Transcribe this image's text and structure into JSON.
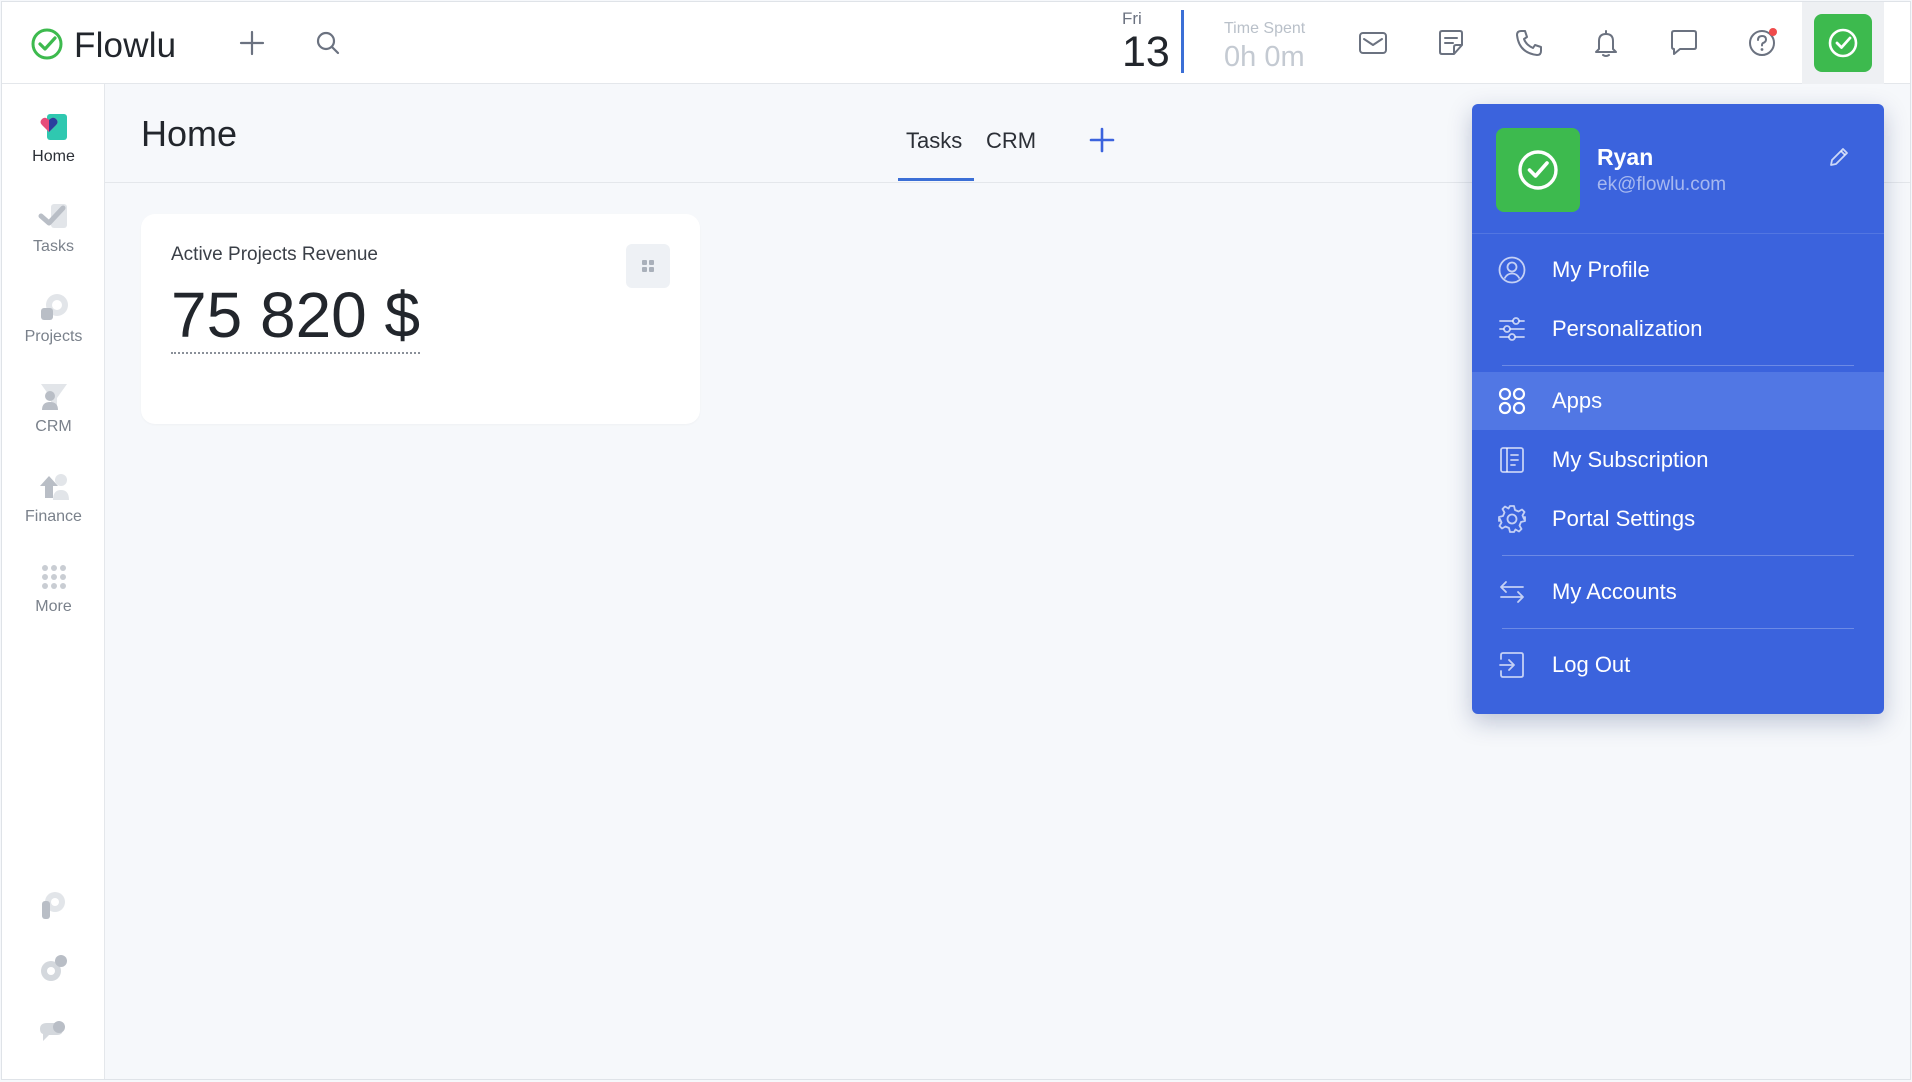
{
  "app": {
    "name": "Flowlu"
  },
  "topbar": {
    "date_day": "Fri",
    "date_num": "13",
    "time_spent_label": "Time Spent",
    "time_spent_value": "0h 0m",
    "icons": [
      "plus-icon",
      "search-icon",
      "mail-icon",
      "notes-icon",
      "phone-icon",
      "bell-icon",
      "chat-icon",
      "help-icon"
    ]
  },
  "sidebar": {
    "items": [
      {
        "label": "Home",
        "icon": "home-icon",
        "active": true
      },
      {
        "label": "Tasks",
        "icon": "tasks-icon"
      },
      {
        "label": "Projects",
        "icon": "projects-icon"
      },
      {
        "label": "CRM",
        "icon": "crm-icon"
      },
      {
        "label": "Finance",
        "icon": "finance-icon"
      },
      {
        "label": "More",
        "icon": "more-icon"
      }
    ]
  },
  "main": {
    "title": "Home",
    "tabs": [
      {
        "label": "Tasks",
        "active": true
      },
      {
        "label": "CRM"
      }
    ],
    "widget": {
      "title": "Active Projects Revenue",
      "value": "75 820 $"
    }
  },
  "user_menu": {
    "name": "Ryan",
    "email": "ek@flowlu.com",
    "items": [
      {
        "label": "My Profile",
        "icon": "user-circle-icon"
      },
      {
        "label": "Personalization",
        "icon": "sliders-icon"
      },
      {
        "label": "Apps",
        "icon": "apps-icon",
        "highlighted": true
      },
      {
        "label": "My Subscription",
        "icon": "subscription-icon"
      },
      {
        "label": "Portal Settings",
        "icon": "gear-icon"
      },
      {
        "label": "My Accounts",
        "icon": "switch-icon"
      },
      {
        "label": "Log Out",
        "icon": "logout-icon"
      }
    ]
  },
  "colors": {
    "accent": "#3b6fd6",
    "menu_bg": "#3b63dd",
    "menu_highlight": "#5177e4",
    "avatar_green": "#3dba4e"
  }
}
